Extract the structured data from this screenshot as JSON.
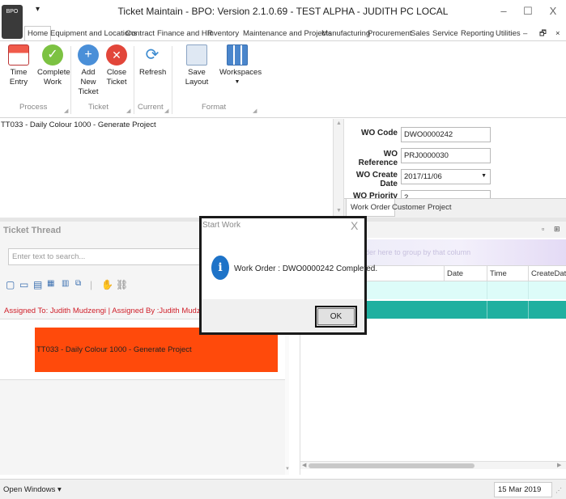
{
  "window": {
    "title": "Ticket Maintain - BPO: Version 2.1.0.69 - TEST ALPHA - JUDITH PC LOCAL",
    "logo_text": "BPO"
  },
  "menu": {
    "tabs": [
      "Home",
      "Equipment and Locations",
      "Contract",
      "Finance and HR",
      "Inventory",
      "Maintenance and Projects",
      "Manufacturing",
      "Procurement",
      "Sales",
      "Service",
      "Reporting",
      "Utilities"
    ]
  },
  "ribbon": {
    "buttons": {
      "time_entry": "Time Entry",
      "complete_work_1": "Complete",
      "complete_work_2": "Work",
      "add_new_ticket_1": "Add New",
      "add_new_ticket_2": "Ticket",
      "close_ticket_1": "Close",
      "close_ticket_2": "Ticket",
      "refresh": "Refresh",
      "save_layout": "Save Layout",
      "workspaces": "Workspaces"
    },
    "groups": {
      "process": "Process",
      "ticket": "Ticket",
      "current": "Current",
      "format": "Format"
    }
  },
  "ticket": {
    "description": "TT033 - Daily Colour 1000 - Generate Project"
  },
  "work_order": {
    "wo_code_label": "WO Code",
    "wo_code_value": "DWO0000242",
    "wo_reference_label": "WO Reference",
    "wo_reference_value": "PRJ0000030",
    "wo_create_date_label": "WO Create Date",
    "wo_create_date_value": "2017/11/06",
    "wo_priority_label": "WO Priority",
    "wo_priority_value": "2",
    "tabs": [
      "Work Order",
      "Customer",
      "Project"
    ]
  },
  "thread": {
    "title": "Ticket Thread",
    "search_placeholder": "Enter text to search...",
    "assigned_line": "Assigned To: Judith Mudzengi | Assigned By :Judith Mudzengi (Created",
    "message": "TT033 - Daily Colour 1000 - Generate Project"
  },
  "grid": {
    "group_hint": "Drag a column header here to group by that column",
    "columns": [
      "Date",
      "Time",
      "CreateDate"
    ]
  },
  "dialog": {
    "title": "Start Work",
    "message": "Work Order : DWO0000242 Completed.",
    "ok_label": "OK"
  },
  "status": {
    "open_windows": "Open Windows",
    "date": "15 Mar 2019"
  },
  "colors": {
    "orange_highlight": "#ff4a0b",
    "selected_row": "#20b0a0",
    "filter_row": "#ddfcf9",
    "info_blue": "#1e73c8",
    "assigned_red": "#d0202a"
  }
}
